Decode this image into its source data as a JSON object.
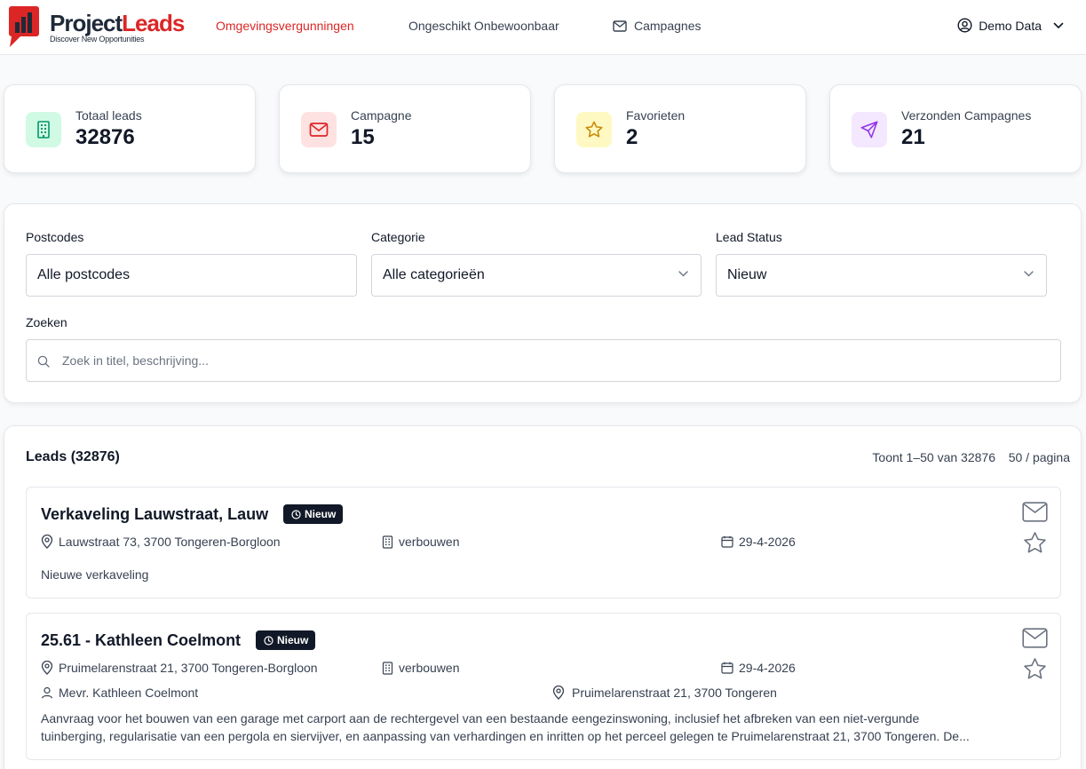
{
  "brand": {
    "name_part1": "Project",
    "name_part2": "Leads",
    "tagline": "Discover New Opportunities"
  },
  "nav": {
    "items": [
      {
        "label": "Omgevingsvergunningen",
        "active": true
      },
      {
        "label": "Ongeschikt Onbewoonbaar",
        "active": false
      },
      {
        "label": "Campagnes",
        "active": false,
        "icon": "mail-icon"
      }
    ],
    "user": {
      "label": "Demo Data",
      "icon": "user-circle-icon"
    }
  },
  "stats": [
    {
      "label": "Totaal leads",
      "value": "32876",
      "icon": "building-icon",
      "icon_bg": "#d1fae5",
      "icon_color": "#059669"
    },
    {
      "label": "Campagne",
      "value": "15",
      "icon": "mail-icon",
      "icon_bg": "#fee2e2",
      "icon_color": "#dc2626"
    },
    {
      "label": "Favorieten",
      "value": "2",
      "icon": "star-icon",
      "icon_bg": "#fef9c3",
      "icon_color": "#ca8a04"
    },
    {
      "label": "Verzonden Campagnes",
      "value": "21",
      "icon": "send-icon",
      "icon_bg": "#f3e8ff",
      "icon_color": "#9333ea"
    }
  ],
  "filters": {
    "postcodes": {
      "label": "Postcodes",
      "value": "Alle postcodes"
    },
    "categorie": {
      "label": "Categorie",
      "value": "Alle categorieën"
    },
    "status": {
      "label": "Lead Status",
      "value": "Nieuw"
    },
    "search": {
      "label": "Zoeken",
      "placeholder": "Zoek in titel, beschrijving..."
    }
  },
  "leads": {
    "title": "Leads (32876)",
    "range": "Toont 1–50 van 32876",
    "per_page": "50 / pagina",
    "items": [
      {
        "title": "Verkaveling Lauwstraat, Lauw",
        "badge": "Nieuw",
        "address": "Lauwstraat 73, 3700 Tongeren-Borgloon",
        "category": "verbouwen",
        "date": "29-4-2026",
        "description": "Nieuwe verkaveling"
      },
      {
        "title": "25.61 - Kathleen Coelmont",
        "badge": "Nieuw",
        "address": "Pruimelarenstraat 21, 3700 Tongeren-Borgloon",
        "category": "verbouwen",
        "date": "29-4-2026",
        "contact": "Mevr. Kathleen Coelmont",
        "contact_address": "Pruimelarenstraat 21, 3700 Tongeren",
        "description_line1": "Aanvraag voor het bouwen van een garage met carport aan de rechtergevel van een bestaande eengezinswoning, inclusief het afbreken van een niet-vergunde",
        "description_line2": "tuinberging, regularisatie van een pergola en siervijver, en aanpassing van verhardingen en inritten op het perceel gelegen te Pruimelarenstraat 21, 3700 Tongeren. De..."
      }
    ]
  },
  "colors": {
    "accent": "#dc2626",
    "badge_bg": "#111827"
  }
}
